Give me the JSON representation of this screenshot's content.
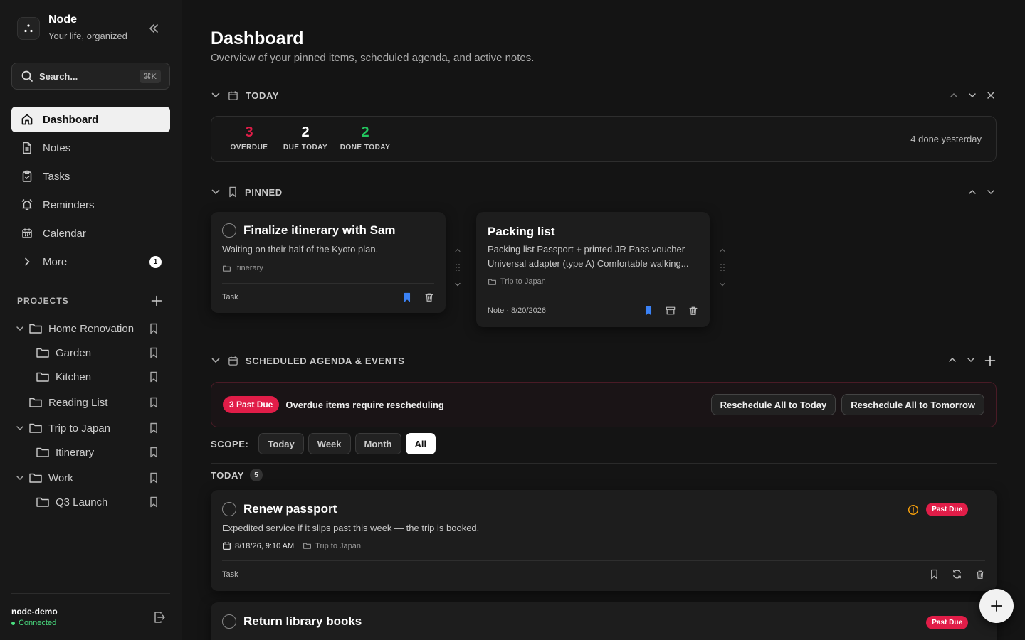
{
  "brand": {
    "title": "Node",
    "subtitle": "Your life, organized"
  },
  "search": {
    "label": "Search...",
    "shortcut": "⌘K"
  },
  "nav": {
    "dashboard": "Dashboard",
    "notes": "Notes",
    "tasks": "Tasks",
    "reminders": "Reminders",
    "calendar": "Calendar",
    "more": "More",
    "more_badge": "1"
  },
  "projects": {
    "title": "PROJECTS",
    "items": [
      {
        "name": "Home Renovation"
      },
      {
        "name": "Garden"
      },
      {
        "name": "Kitchen"
      },
      {
        "name": "Reading List"
      },
      {
        "name": "Trip to Japan"
      },
      {
        "name": "Itinerary"
      },
      {
        "name": "Work"
      },
      {
        "name": "Q3 Launch"
      }
    ]
  },
  "user": {
    "name": "node-demo",
    "status": "Connected"
  },
  "header": {
    "title": "Dashboard",
    "subtitle": "Overview of your pinned items, scheduled agenda, and active notes."
  },
  "today": {
    "label": "TODAY",
    "overdue": "3",
    "overdue_label": "OVERDUE",
    "due_today": "2",
    "due_today_label": "DUE TODAY",
    "done_today": "2",
    "done_today_label": "DONE TODAY",
    "done_yesterday": "4 done yesterday"
  },
  "pinned": {
    "label": "PINNED",
    "cards": [
      {
        "title": "Finalize itinerary with Sam",
        "desc": "Waiting on their half of the Kyoto plan.",
        "folder": "Itinerary",
        "type": "Task"
      },
      {
        "title": "Packing list",
        "desc1": "Packing list Passport + printed JR Pass voucher",
        "desc2": "Universal adapter (type A) Comfortable walking...",
        "folder": "Trip to Japan",
        "type": "Note · 8/20/2026"
      }
    ]
  },
  "agenda": {
    "label": "SCHEDULED AGENDA & EVENTS",
    "past_due_pill": "3 Past Due",
    "banner_text": "Overdue items require rescheduling",
    "reschedule_today": "Reschedule All to Today",
    "reschedule_tomorrow": "Reschedule All to Tomorrow",
    "scope_label": "SCOPE:",
    "scopes": [
      "Today",
      "Week",
      "Month",
      "All"
    ],
    "group_label": "TODAY",
    "group_count": "5",
    "items": [
      {
        "title": "Renew passport",
        "desc": "Expedited service if it slips past this week — the trip is booked.",
        "date": "8/18/26, 9:10 AM",
        "folder": "Trip to Japan",
        "type": "Task",
        "badge": "Past Due"
      },
      {
        "title": "Return library books",
        "badge": "Past Due"
      }
    ]
  },
  "colors": {
    "overdue": "#e11d48",
    "done": "#22c55e",
    "accent": "#3b82f6",
    "warning": "#f59e0b"
  }
}
